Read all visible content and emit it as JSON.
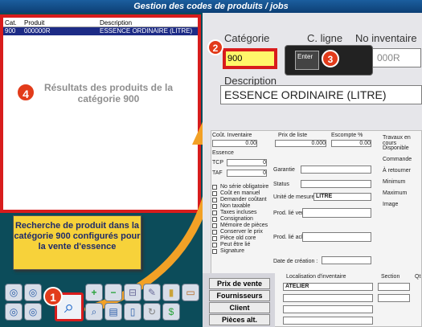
{
  "window": {
    "title": "Gestion des codes de produits / jobs"
  },
  "results": {
    "headers": [
      "Cat.",
      "Produit",
      "Description"
    ],
    "rows": [
      {
        "cat": "900",
        "produit": "000000R",
        "description": "ESSENCE ORDINAIRE (LITRE)"
      }
    ],
    "note_number": "4",
    "note": "Résultats des produits de la catégorie 900"
  },
  "callout": {
    "text": "Recherche de produit dans la catégorie 900 configurés pour la vente d'essence"
  },
  "steps": {
    "one": "1",
    "two": "2",
    "three": "3"
  },
  "form": {
    "categorie_label": "Catégorie",
    "categorie_value": "900",
    "ligne_label": "C. ligne",
    "inventaire_label": "No inventaire",
    "inventaire_value": "000R",
    "enter_label": "Enter",
    "description_label": "Description",
    "description_value": "ESSENCE ORDINAIRE (LITRE)",
    "cout_label": "Coût. Inventaire",
    "cout_value": "0.00",
    "prix_label": "Prix de liste",
    "prix_value": "0.000",
    "escompte_label": "Escompte %",
    "escompte_value": "0.00",
    "essence_label": "Essence",
    "tcp_label": "TCP",
    "tcp_value": "0",
    "taf_label": "TAF",
    "taf_value": "0",
    "checkboxes": [
      "No série obligatoire",
      "Coût en manuel",
      "Demander coûtant",
      "Non taxable",
      "Taxes incluses",
      "Consignation",
      "Mémoire de pièces",
      "Conserver le prix",
      "Pièce old core",
      "Peut être lié",
      "Signature"
    ],
    "garantie_label": "Garantie",
    "status_label": "Status",
    "unite_label": "Unité de mesure",
    "unite_value": "LITRE",
    "prod_vente_label": "Prod. lié vente :",
    "prod_achat_label": "Prod. lié achat :",
    "date_label": "Date de création :",
    "travaux_label": "Travaux en cours",
    "travaux_items": [
      "Disponible",
      "Commande",
      "À retourner",
      "Minimum",
      "Maximum"
    ],
    "image_label": "Image",
    "nav_buttons": [
      "Prix de vente",
      "Fournisseurs",
      "Client",
      "Pièces alt."
    ],
    "localisation_label": "Localisation d'inventaire",
    "localisation_value": "ATELIER",
    "section_label": "Section",
    "qte_label": "Qt"
  }
}
